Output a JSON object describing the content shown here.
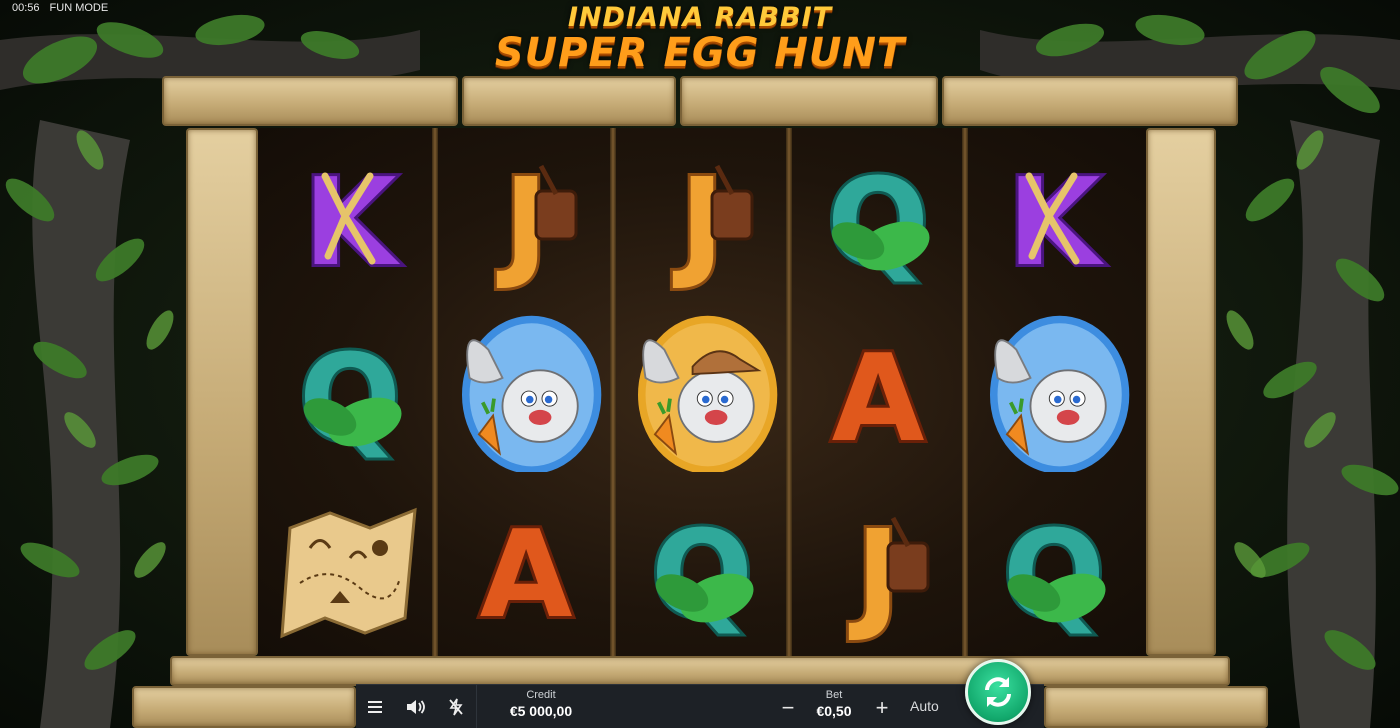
{
  "status_bar": {
    "time": "00:56",
    "mode": "FUN MODE"
  },
  "title": {
    "line1": "INDIANA RABBIT",
    "line2": "SUPER EGG HUNT"
  },
  "reels": [
    [
      "K",
      "Q",
      "map-scatter"
    ],
    [
      "J",
      "rabbit-egg-blue",
      "A"
    ],
    [
      "J",
      "rabbit-egg-gold",
      "Q"
    ],
    [
      "Q",
      "A",
      "J"
    ],
    [
      "K",
      "rabbit-egg-blue",
      "Q"
    ]
  ],
  "controls": {
    "menu_icon": "menu-icon",
    "sound_icon": "speaker-icon",
    "turbo_icon": "lightning-off-icon",
    "credit_label": "Credit",
    "credit_value": "€5 000,00",
    "bet_label": "Bet",
    "bet_value": "€0,50",
    "minus_label": "−",
    "plus_label": "+",
    "auto_label": "Auto",
    "spin_icon": "spin-arrows-icon"
  },
  "colors": {
    "spin_button": "#12a86c",
    "title": "#ff9d1a",
    "bar_bg": "#1d2126"
  }
}
